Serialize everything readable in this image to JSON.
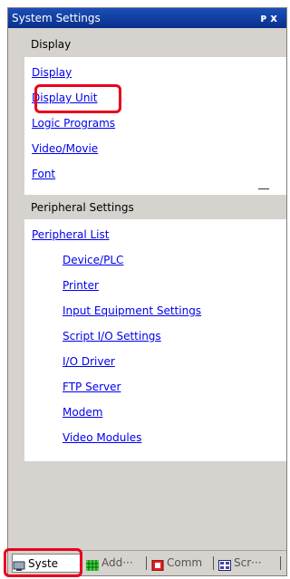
{
  "window": {
    "title": "System Settings",
    "pin_glyph": "ᴩ",
    "close_glyph": "x"
  },
  "display_section": {
    "label": "Display",
    "items": [
      "Display",
      "Display Unit",
      "Logic Programs",
      "Video/Movie",
      "Font"
    ]
  },
  "peripheral_section": {
    "label": "Peripheral Settings",
    "items": [
      "Peripheral List",
      "Device/PLC",
      "Printer",
      "Input Equipment Settings",
      "Script I/O Settings",
      "I/O Driver",
      "FTP Server",
      "Modem",
      "Video Modules"
    ]
  },
  "tabs": [
    {
      "label": "Syste",
      "icon": "system-settings-icon"
    },
    {
      "label": "Add···",
      "icon": "address-icon"
    },
    {
      "label": "Comm",
      "icon": "common-icon"
    },
    {
      "label": "Scr···",
      "icon": "screen-list-icon"
    }
  ],
  "colors": {
    "title_bar": "#0a2f8c",
    "link": "#0000ee",
    "highlight": "#e8001c",
    "panel_bg": "#d6d3ce"
  }
}
